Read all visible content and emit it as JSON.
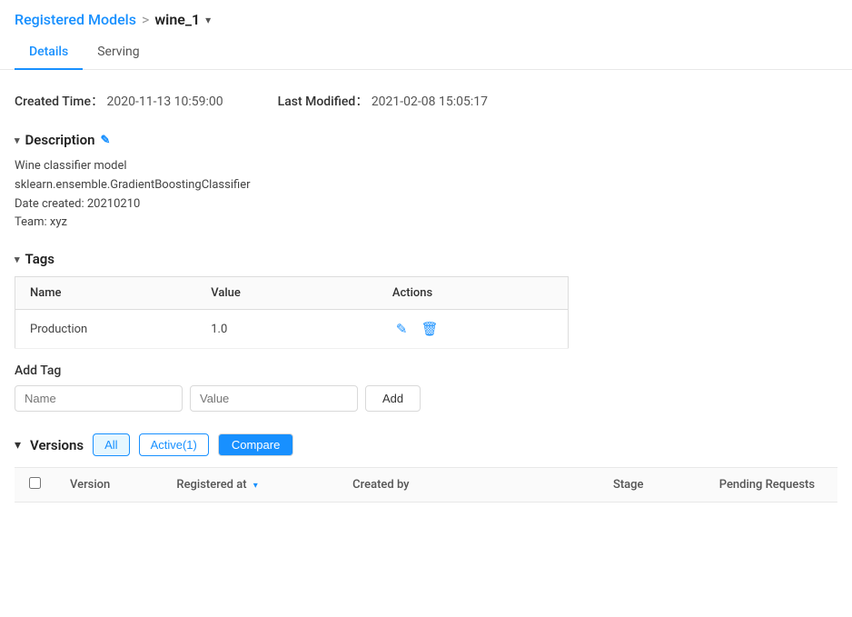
{
  "breadcrumb": {
    "parent_label": "Registered Models",
    "separator": ">",
    "current": "wine_1",
    "dropdown_arrow": "▾"
  },
  "tabs": [
    {
      "id": "details",
      "label": "Details",
      "active": true
    },
    {
      "id": "serving",
      "label": "Serving",
      "active": false
    }
  ],
  "meta": {
    "created_label": "Created Time：",
    "created_value": "2020-11-13 10:59:00",
    "modified_label": "Last Modified：",
    "modified_value": "2021-02-08 15:05:17"
  },
  "description": {
    "section_title": "Description",
    "edit_icon": "✎",
    "lines": [
      "Wine classifier model",
      "sklearn.ensemble.GradientBoostingClassifier",
      "Date created: 20210210",
      "Team: xyz"
    ]
  },
  "tags": {
    "section_title": "Tags",
    "columns": [
      "Name",
      "Value",
      "Actions"
    ],
    "rows": [
      {
        "name": "Production",
        "value": "1.0"
      }
    ],
    "add_tag_label": "Add Tag",
    "name_placeholder": "Name",
    "value_placeholder": "Value",
    "add_button_label": "Add",
    "edit_icon": "✎",
    "delete_icon": "🗑"
  },
  "versions": {
    "section_title": "Versions",
    "filters": [
      {
        "label": "All",
        "active": true
      },
      {
        "label": "Active(1)",
        "active": false
      }
    ],
    "compare_button": "Compare",
    "columns": [
      "",
      "Version",
      "Registered at",
      "Created by",
      "Stage",
      "Pending Requests"
    ],
    "sort_col": "Registered at"
  },
  "icons": {
    "toggle_arrow": "▾",
    "sort_down": "▾"
  }
}
